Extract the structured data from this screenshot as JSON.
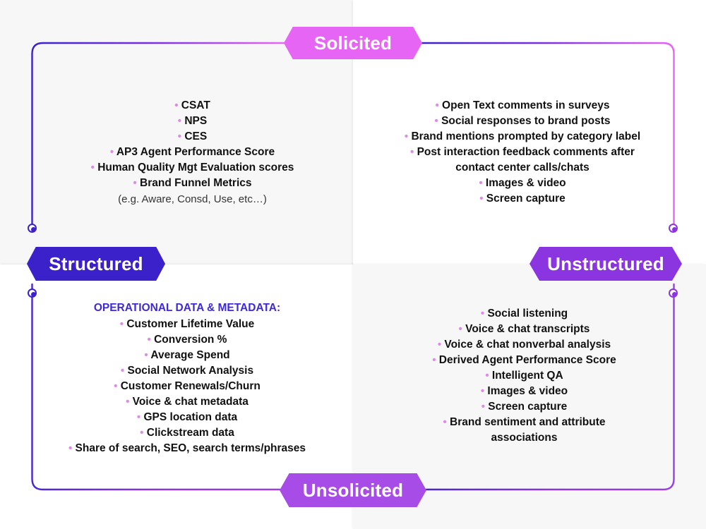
{
  "axes": {
    "solicited": "Solicited",
    "unsolicited": "Unsolicited",
    "structured": "Structured",
    "unstructured": "Unstructured"
  },
  "colors": {
    "solicited": "#e765f5",
    "unsolicited": "#a84ce8",
    "structured": "#3b21c9",
    "unstructured": "#8b35e0",
    "bullet": "#dd8ae8",
    "section_head": "#3d2ad6",
    "frame_start": "#3b21c9",
    "frame_end": "#e765f5"
  },
  "quadrants": {
    "structured_solicited": {
      "items": [
        "CSAT",
        "NPS",
        "CES",
        "AP3 Agent Performance Score",
        "Human Quality Mgt Evaluation scores",
        "Brand Funnel Metrics"
      ],
      "note": "(e.g. Aware, Consd, Use, etc…)"
    },
    "unstructured_solicited": {
      "items": [
        "Open Text comments in surveys",
        "Social responses to brand posts",
        "Brand mentions prompted by category label",
        "Post interaction feedback comments after contact center calls/chats",
        "Images & video",
        "Screen capture"
      ]
    },
    "structured_unsolicited": {
      "heading": "OPERATIONAL DATA & METADATA:",
      "items": [
        "Customer Lifetime Value",
        "Conversion %",
        "Average Spend",
        "Social Network Analysis",
        "Customer Renewals/Churn",
        "Voice & chat metadata",
        "GPS location data",
        "Clickstream data",
        "Share of search, SEO, search terms/phrases"
      ]
    },
    "unstructured_unsolicited": {
      "items": [
        "Social listening",
        "Voice & chat transcripts",
        "Voice & chat nonverbal analysis",
        "Derived Agent Performance Score",
        "Intelligent QA",
        "Images & video",
        "Screen capture",
        "Brand sentiment and attribute associations"
      ]
    }
  }
}
